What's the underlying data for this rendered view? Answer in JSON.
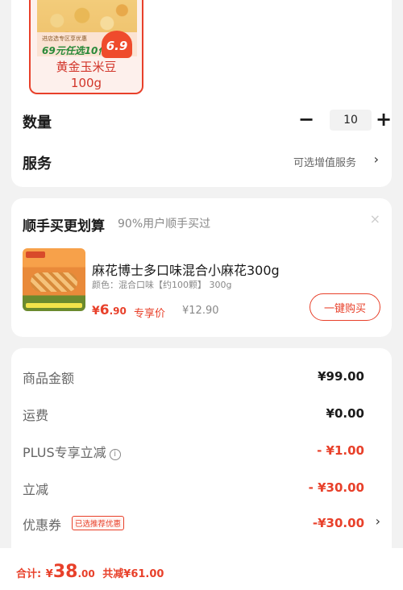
{
  "product_thumb": {
    "promo_small": "进店选专区享优惠",
    "promo_deal": "69元任选10件",
    "promo_price": "6.9",
    "name": "黄金玉米豆",
    "weight": "100g"
  },
  "quantity": {
    "label": "数量",
    "minus": "−",
    "value": "10",
    "plus": "+"
  },
  "service": {
    "label": "服务",
    "value": "可选增值服务",
    "chevron": "›"
  },
  "recommend": {
    "title": "顺手买更划算",
    "subtitle": "90%用户顺手买过",
    "close": "×",
    "item": {
      "name": "麻花博士多口味混合小麻花300g",
      "spec": "颜色：混合口味【约100颗】 300g",
      "price_symbol": "¥",
      "price_int": "6",
      "price_dec": ".90",
      "price_tag": "专享价",
      "original_price": "¥12.90",
      "buy_label": "一键购买"
    }
  },
  "price_breakdown": [
    {
      "label": "商品金额",
      "value": "¥99.00",
      "red": false
    },
    {
      "label": "运费",
      "value": "¥0.00",
      "red": false
    },
    {
      "label": "PLUS专享立减",
      "value": "- ¥1.00",
      "red": true,
      "info_icon": "i"
    },
    {
      "label": "立减",
      "value": "- ¥30.00",
      "red": true
    },
    {
      "label": "优惠券",
      "value": "-¥30.00",
      "red": true,
      "badge": "已选推荐优惠",
      "chevron": "›"
    }
  ],
  "bottom_bar": {
    "total_label": "合计:",
    "total_symbol": "¥",
    "total_int": "38",
    "total_dec": ".00",
    "saved": "共减¥61.00"
  },
  "colors": {
    "accent": "#e8402a",
    "background": "#f2f2f2",
    "card": "#ffffff"
  }
}
